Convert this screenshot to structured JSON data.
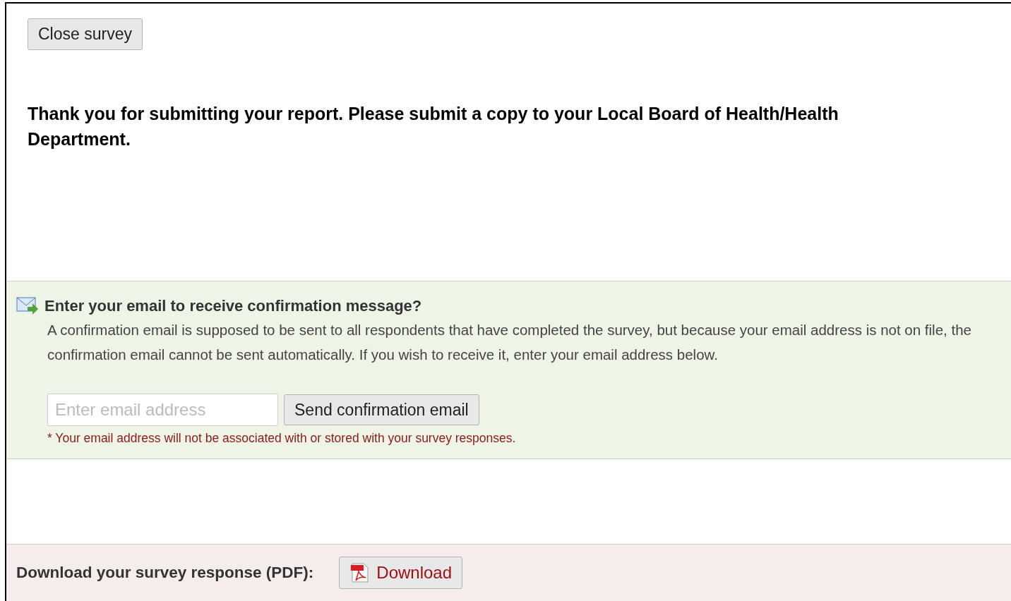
{
  "close_button": {
    "label": "Close survey"
  },
  "thank_you": "Thank you for submitting your report. Please submit a copy to your Local Board of Health/Health Department.",
  "email_section": {
    "title": "Enter your email to receive confirmation message?",
    "description": "A confirmation email is supposed to be sent to all respondents that have completed the survey, but because your email address is not on file, the confirmation email cannot be sent automatically. If you wish to receive it, enter your email address below.",
    "email_field": {
      "placeholder": "Enter email address"
    },
    "send_button": {
      "label": "Send confirmation email"
    },
    "note": "* Your email address will not be associated with or stored with your survey responses."
  },
  "download_section": {
    "label": "Download your survey response (PDF):",
    "button": {
      "label": "Download"
    }
  }
}
